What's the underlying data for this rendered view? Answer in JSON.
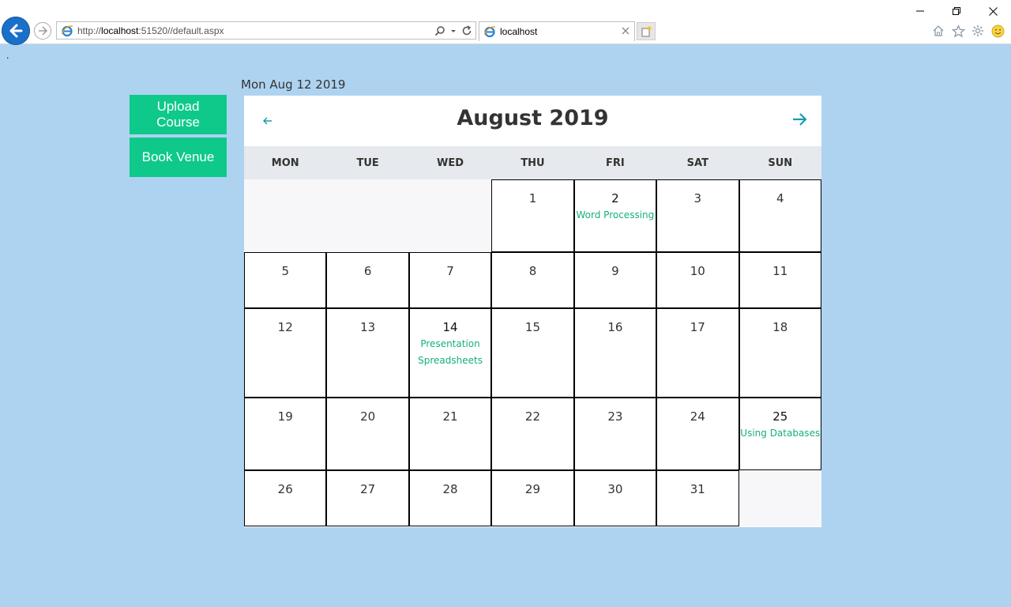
{
  "browser": {
    "url_prefix": "http://",
    "url_host": "localhost",
    "url_rest": ":51520//default.aspx",
    "tab_title": "localhost"
  },
  "page": {
    "dot": ".",
    "current_date": "Mon Aug 12 2019",
    "upload_label": "Upload Course",
    "book_label": "Book Venue"
  },
  "calendar": {
    "title": "August 2019",
    "prev_symbol": "←",
    "days_of_week": [
      "MON",
      "TUE",
      "WED",
      "THU",
      "FRI",
      "SAT",
      "SUN"
    ],
    "weeks": [
      [
        null,
        null,
        null,
        {
          "day": "1",
          "events": []
        },
        {
          "day": "2",
          "events": [
            "Word Processing"
          ]
        },
        {
          "day": "3",
          "events": []
        },
        {
          "day": "4",
          "events": []
        }
      ],
      [
        {
          "day": "5",
          "events": []
        },
        {
          "day": "6",
          "events": []
        },
        {
          "day": "7",
          "events": []
        },
        {
          "day": "8",
          "events": []
        },
        {
          "day": "9",
          "events": []
        },
        {
          "day": "10",
          "events": []
        },
        {
          "day": "11",
          "events": []
        }
      ],
      [
        {
          "day": "12",
          "events": []
        },
        {
          "day": "13",
          "events": []
        },
        {
          "day": "14",
          "events": [
            "Presentation",
            "Spreadsheets"
          ]
        },
        {
          "day": "15",
          "events": []
        },
        {
          "day": "16",
          "events": []
        },
        {
          "day": "17",
          "events": []
        },
        {
          "day": "18",
          "events": []
        }
      ],
      [
        {
          "day": "19",
          "events": []
        },
        {
          "day": "20",
          "events": []
        },
        {
          "day": "21",
          "events": []
        },
        {
          "day": "22",
          "events": []
        },
        {
          "day": "23",
          "events": []
        },
        {
          "day": "24",
          "events": []
        },
        {
          "day": "25",
          "events": [
            "Using Databases"
          ]
        }
      ],
      [
        {
          "day": "26",
          "events": []
        },
        {
          "day": "27",
          "events": []
        },
        {
          "day": "28",
          "events": []
        },
        {
          "day": "29",
          "events": []
        },
        {
          "day": "30",
          "events": []
        },
        {
          "day": "31",
          "events": []
        },
        null
      ]
    ]
  },
  "colors": {
    "page_background": "#aed3f1",
    "accent_green": "#0ec98a",
    "event_text": "#14b07a",
    "nav_arrow": "#1a9bb0",
    "ie_back": "#1a6fc9"
  },
  "icons": [
    "back-arrow-icon",
    "forward-arrow-icon",
    "ie-logo-icon",
    "search-icon",
    "dropdown-icon",
    "refresh-icon",
    "close-icon",
    "new-tab-icon",
    "minimize-icon",
    "restore-icon",
    "home-icon",
    "star-icon",
    "gear-icon",
    "smiley-icon"
  ]
}
